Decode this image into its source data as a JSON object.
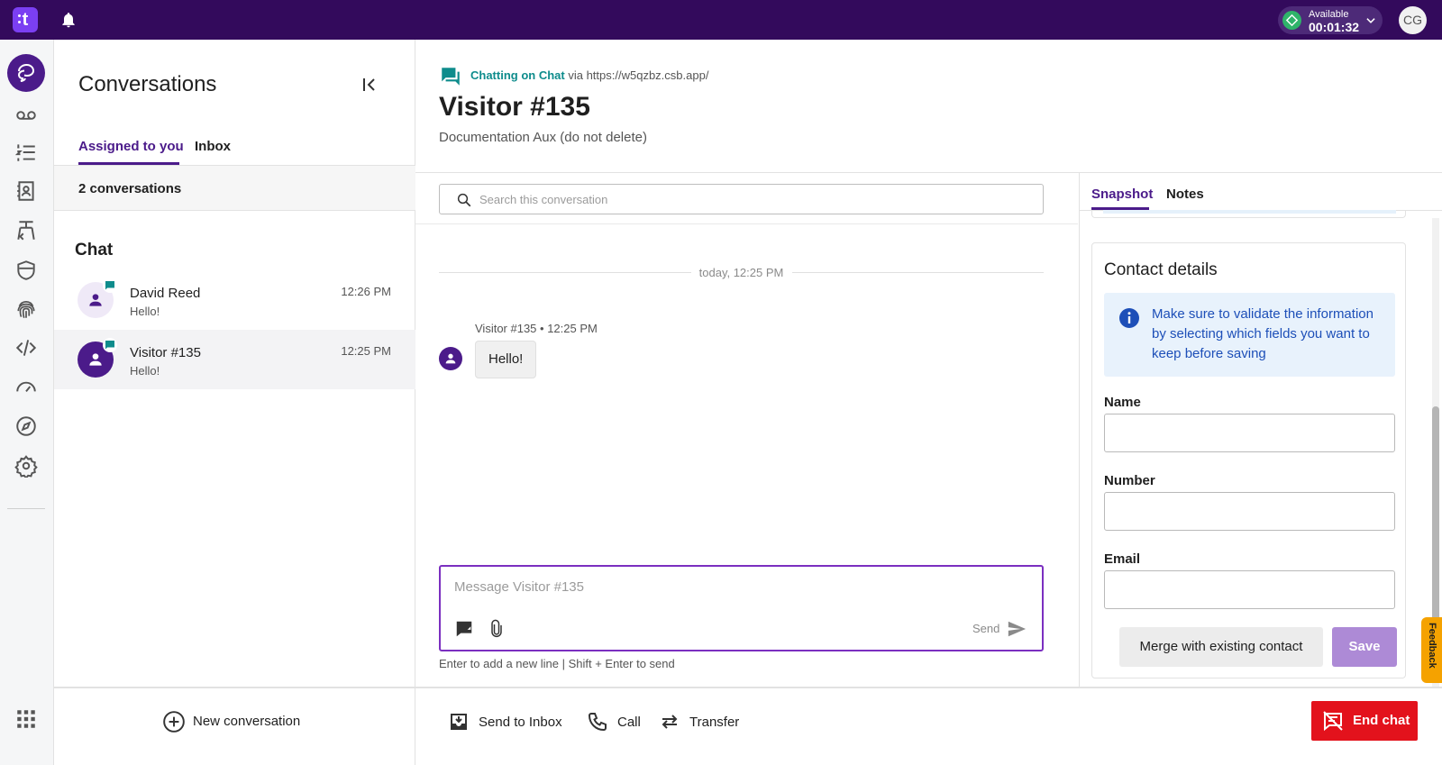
{
  "topbar": {
    "logo_text": "t",
    "status_label": "Available",
    "status_time": "00:01:32",
    "user_initials": "CG"
  },
  "rail": {
    "items": [
      "conversations",
      "voicemail",
      "queues",
      "contacts",
      "routing",
      "security",
      "biometrics",
      "developer",
      "dashboard",
      "explore",
      "settings",
      "apps"
    ]
  },
  "conversations": {
    "title": "Conversations",
    "tabs": [
      "Assigned to you",
      "Inbox"
    ],
    "count": "2 conversations",
    "section": "Chat",
    "items": [
      {
        "name": "David Reed",
        "preview": "Hello!",
        "time": "12:26 PM"
      },
      {
        "name": "Visitor #135",
        "preview": "Hello!",
        "time": "12:25 PM"
      }
    ],
    "new_conversation": "New conversation"
  },
  "chat": {
    "channel": "Chatting on Chat",
    "via": "via https://w5qzbz.csb.app/",
    "visitor": "Visitor #135",
    "queue": "Documentation Aux (do not delete)",
    "search_placeholder": "Search this conversation",
    "date_separator": "today, 12:25 PM",
    "message_meta": "Visitor #135 • 12:25 PM",
    "message_text": "Hello!",
    "composer_placeholder": "Message Visitor #135",
    "send_label": "Send",
    "hint": "Enter to add a new line | Shift + Enter to send"
  },
  "footer": {
    "send_to_inbox": "Send to Inbox",
    "call": "Call",
    "transfer": "Transfer",
    "end_chat": "End chat"
  },
  "snapshot": {
    "tabs": [
      "Snapshot",
      "Notes"
    ],
    "card_title": "Contact details",
    "info_text": "Make sure to validate the information by selecting which fields you want to keep before saving",
    "fields": [
      "Name",
      "Number",
      "Email"
    ],
    "merge_label": "Merge with existing contact",
    "save_label": "Save"
  },
  "feedback_label": "Feedback",
  "colors": {
    "brand": "#330a5c",
    "accent": "#4b1b8a",
    "teal": "#0e8c8c",
    "danger": "#e3121c",
    "available": "#2fb36a",
    "feedback": "#f5a200"
  }
}
